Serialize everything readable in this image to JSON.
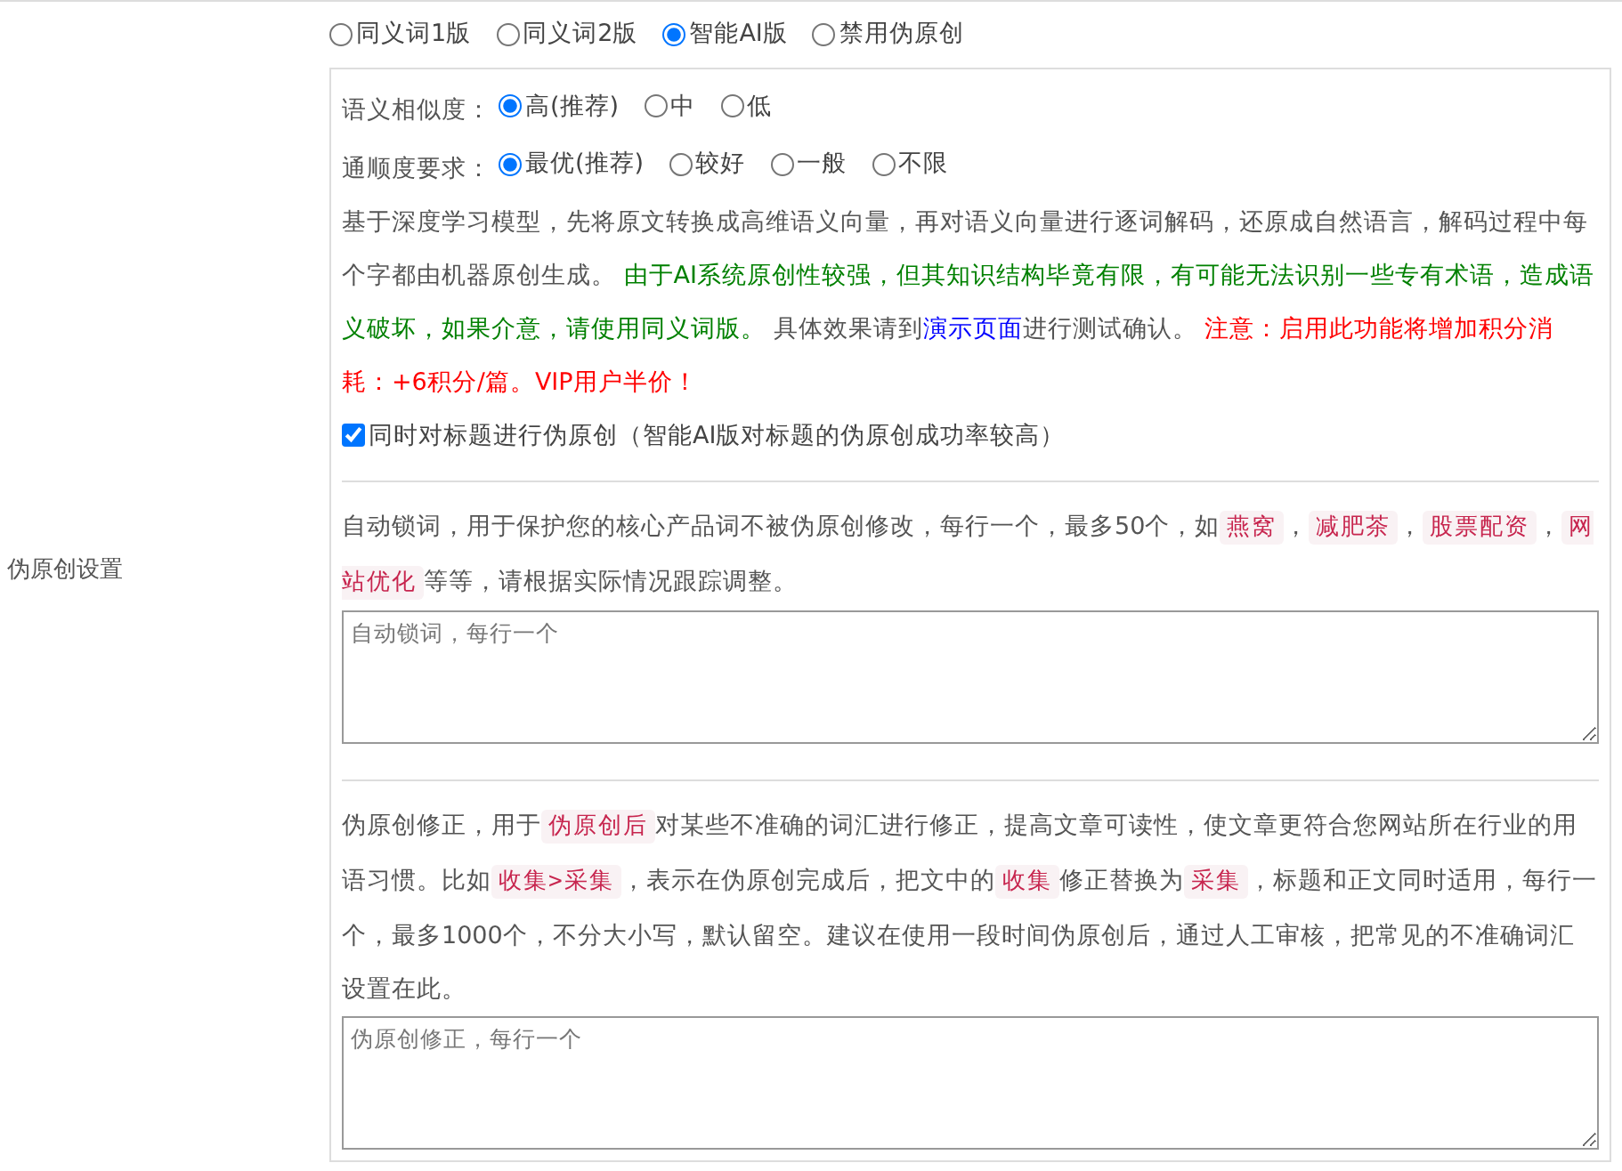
{
  "mode_options": [
    {
      "label": "同义词1版",
      "selected": false
    },
    {
      "label": "同义词2版",
      "selected": false
    },
    {
      "label": "智能AI版",
      "selected": true
    },
    {
      "label": "禁用伪原创",
      "selected": false
    }
  ],
  "similarity": {
    "label": "语义相似度：",
    "options": [
      {
        "label": "高(推荐)",
        "selected": true
      },
      {
        "label": "中",
        "selected": false
      },
      {
        "label": "低",
        "selected": false
      }
    ]
  },
  "fluency": {
    "label": "通顺度要求：",
    "options": [
      {
        "label": "最优(推荐)",
        "selected": true
      },
      {
        "label": "较好",
        "selected": false
      },
      {
        "label": "一般",
        "selected": false
      },
      {
        "label": "不限",
        "selected": false
      }
    ]
  },
  "description": [
    {
      "kind": "plain",
      "text": "基于深度学习模型，先将原文转换成高维语义向量，再对语义向量进行逐词解码，还原成自然语言，解码过程中每个字都由机器原创生成。 "
    },
    {
      "kind": "green",
      "text": "由于AI系统原创性较强，但其知识结构毕竟有限，有可能无法识别一些专有术语，造成语义破坏，如果介意，请使用同义词版。"
    },
    {
      "kind": "plain",
      "text": " 具体效果请到"
    },
    {
      "kind": "link",
      "text": "演示页面"
    },
    {
      "kind": "plain",
      "text": "进行测试确认。 "
    },
    {
      "kind": "red",
      "text": "注意：启用此功能将增加积分消耗：+6积分/篇。VIP用户半价！"
    }
  ],
  "title_option": {
    "label": "同时对标题进行伪原创（智能AI版对标题的伪原创成功率较高）",
    "checked": true
  },
  "lock_words": {
    "side_label": "伪原创设置",
    "description": [
      {
        "kind": "plain",
        "text": "自动锁词，用于保护您的核心产品词不被伪原创修改，每行一个，最多50个，如"
      },
      {
        "kind": "tag",
        "text": "燕窝"
      },
      {
        "kind": "plain",
        "text": "，"
      },
      {
        "kind": "tag",
        "text": "减肥茶"
      },
      {
        "kind": "plain",
        "text": "，"
      },
      {
        "kind": "tag",
        "text": "股票配资"
      },
      {
        "kind": "plain",
        "text": "，"
      },
      {
        "kind": "tag",
        "text": "网站优化"
      },
      {
        "kind": "plain",
        "text": "等等，请根据实际情况跟踪调整。"
      }
    ],
    "placeholder": "自动锁词，每行一个"
  },
  "correction": {
    "description": [
      {
        "kind": "plain",
        "text": "伪原创修正，用于"
      },
      {
        "kind": "tag",
        "text": "伪原创后"
      },
      {
        "kind": "plain",
        "text": "对某些不准确的词汇进行修正，提高文章可读性，使文章更符合您网站所在行业的用语习惯。比如"
      },
      {
        "kind": "tag",
        "text": "收集>采集"
      },
      {
        "kind": "plain",
        "text": "，表示在伪原创完成后，把文中的"
      },
      {
        "kind": "tag",
        "text": "收集"
      },
      {
        "kind": "plain",
        "text": "修正替换为"
      },
      {
        "kind": "tag",
        "text": "采集"
      },
      {
        "kind": "plain",
        "text": "，标题和正文同时适用，每行一个，最多1000个，不分大小写，默认留空。建议在使用一段时间伪原创后，通过人工审核，把常见的不准确词汇设置在此。"
      }
    ],
    "placeholder": "伪原创修正，每行一个"
  }
}
